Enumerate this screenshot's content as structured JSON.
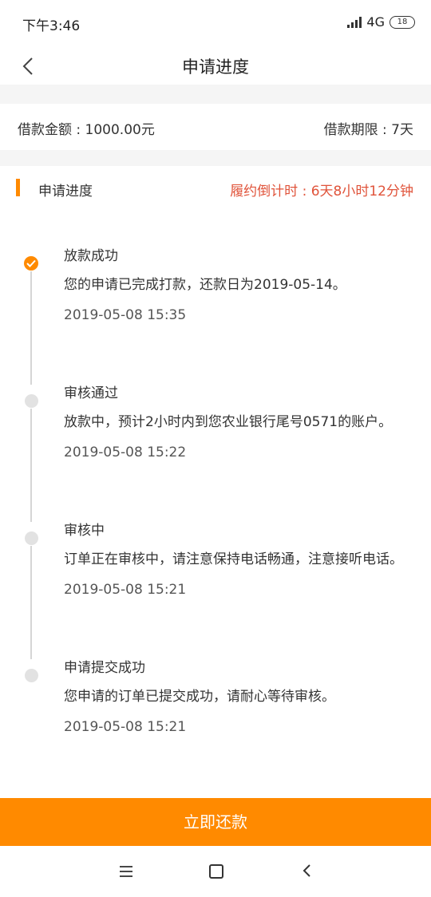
{
  "status_bar": {
    "time": "下午3:46",
    "network": "4G",
    "battery": "18"
  },
  "header": {
    "title": "申请进度",
    "back_icon": "chevron-left-icon"
  },
  "loan": {
    "amount_text": "借款金额 : 1000.00元",
    "term_text": "借款期限 : 7天"
  },
  "progress": {
    "section_title": "申请进度",
    "countdown_text": "履约倒计时 : 6天8小时12分钟",
    "accent_color": "#FF8A00",
    "countdown_color": "#E0533A",
    "steps": [
      {
        "title": "放款成功",
        "desc": "您的申请已完成打款，还款日为2019-05-14。",
        "time": "2019-05-08 15:35",
        "status": "done"
      },
      {
        "title": "审核通过",
        "desc": "放款中，预计2小时内到您农业银行尾号0571的账户。",
        "time": "2019-05-08 15:22",
        "status": "pending"
      },
      {
        "title": "审核中",
        "desc": "订单正在审核中，请注意保持电话畅通，注意接听电话。",
        "time": "2019-05-08 15:21",
        "status": "pending"
      },
      {
        "title": "申请提交成功",
        "desc": "您申请的订单已提交成功，请耐心等待审核。",
        "time": "2019-05-08 15:21",
        "status": "pending"
      }
    ]
  },
  "actions": {
    "repay_label": "立即还款",
    "button_color": "#FF8A00"
  },
  "system_nav": {
    "menu_icon": "menu-icon",
    "home_icon": "home-icon",
    "back_icon": "back-icon"
  }
}
